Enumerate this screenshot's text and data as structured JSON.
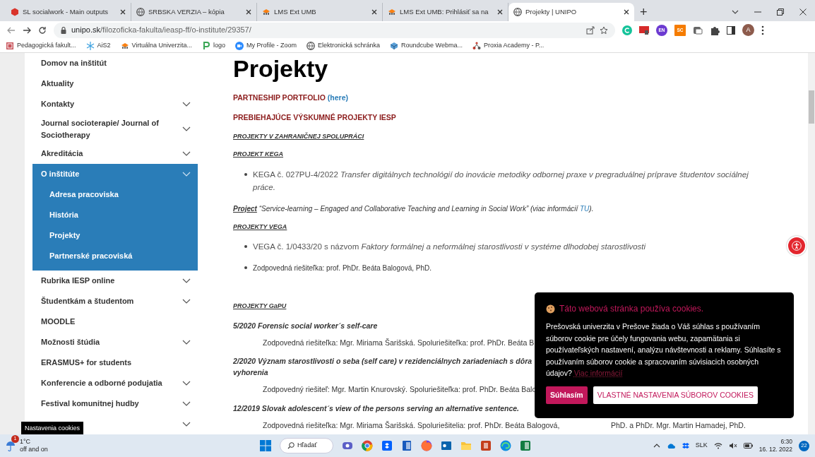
{
  "browser": {
    "tabs": [
      {
        "title": "SL socialwork - Main outputs",
        "selected": false
      },
      {
        "title": "SRBSKA VERZIA – kópia",
        "selected": false
      },
      {
        "title": "LMS Ext UMB",
        "selected": false
      },
      {
        "title": "LMS Ext UMB: Prihlásiť sa na",
        "selected": false
      },
      {
        "title": "Projekty | UNIPO",
        "selected": true
      }
    ],
    "new_tab": "+",
    "address_bar": {
      "domain": "unipo.sk",
      "path": "/filozoficka-fakulta/ieasp-ff/o-institute/29357/"
    },
    "extensions": [
      "EN",
      "SC"
    ],
    "profile_initial": "A",
    "bookmarks": [
      "Pedagogická fakult...",
      "AiS2",
      "Virtuálna Univerzita...",
      "logo",
      "My Profile - Zoom",
      "Elektronická schránka",
      "Roundcube Webma...",
      "Proxia Academy - P..."
    ]
  },
  "sidebar": {
    "items": [
      {
        "label": "Domov na inštitút",
        "expandable": false,
        "expanded": false
      },
      {
        "label": "Aktuality",
        "expandable": false,
        "expanded": false
      },
      {
        "label": "Kontakty",
        "expandable": true,
        "expanded": false
      },
      {
        "label": "Journal socioterapie/ Journal of Sociotherapy",
        "expandable": true,
        "expanded": false
      },
      {
        "label": "Akreditácia",
        "expandable": true,
        "expanded": false
      },
      {
        "label": "O inštitúte",
        "expandable": true,
        "expanded": true,
        "children": [
          {
            "label": "Adresa pracoviska"
          },
          {
            "label": "História"
          },
          {
            "label": "Projekty"
          },
          {
            "label": "Partnerské pracoviská"
          }
        ]
      },
      {
        "label": "Rubrika IESP online",
        "expandable": true,
        "expanded": false
      },
      {
        "label": "Študentkám a študentom",
        "expandable": true,
        "expanded": false
      },
      {
        "label": "MOODLE",
        "expandable": false,
        "expanded": false
      },
      {
        "label": "Možnosti štúdia",
        "expandable": true,
        "expanded": false
      },
      {
        "label": "ERASMUS+ for students",
        "expandable": false,
        "expanded": false
      },
      {
        "label": "Konferencie a odborné podujatia",
        "expandable": true,
        "expanded": false
      },
      {
        "label": "Festival komunitnej hudby",
        "expandable": true,
        "expanded": false
      },
      {
        "expandable": true,
        "expanded": false
      }
    ]
  },
  "page": {
    "title": "Projekty",
    "blocks": [
      {
        "kind": "heading",
        "text": "PARTNESHIP PORTFOLIO",
        "link": "(here)"
      },
      {
        "kind": "heading",
        "text": "PREBIEHAJÚCE VÝSKUMNÉ PROJEKTY IESP"
      },
      {
        "kind": "subheading",
        "text": "PROJEKTY V ZAHRANIČNEJ SPOLUPRÁCI"
      },
      {
        "kind": "subheading",
        "text": "PROJEKT KEGA"
      },
      {
        "kind": "bullet",
        "text": "KEGA č. 027PU-4/2022 *Transfer digitálnych technológií do inovácie metodiky odbornej praxe v pregraduálnej príprave študentov sociálnej práce.*"
      },
      {
        "kind": "project",
        "lead": "Project",
        "text": "“Service-learning – Engaged and Collaborative Teaching and Learning in Social Work”   (viac informácií",
        "link": "TU",
        "tail": ")."
      },
      {
        "kind": "subheading",
        "text": "PROJEKTY VEGA"
      },
      {
        "kind": "bullet",
        "text": "VEGA č. 1/0433/20 s názvom *Faktory formálnej a neformálnej starostlivosti v systéme dlhodobej starostlivosti*"
      },
      {
        "kind": "bullet-small",
        "text": "Zodpovedná riešiteľka: prof. PhDr. Beáta Balogová, PhD."
      },
      {
        "kind": "subheading",
        "text": "PROJEKTY GaPU"
      },
      {
        "kind": "title",
        "lines": [
          "5/2020 Forensic social worker´s self-care"
        ]
      },
      {
        "kind": "person",
        "parts": [
          "Zodpovedná riešiteľka: Mgr. Miriama Šarišská. Spoluriešiteľka: prof. PhDr. Beáta B"
        ]
      },
      {
        "kind": "title",
        "lines": [
          "2/2020 Význam starostlivosti o seba (self care) v rezidenciálnych zariadeniach s dôra",
          "vyhorenia"
        ]
      },
      {
        "kind": "person",
        "parts": [
          "Zodpovedný riešiteľ: Mgr. Martin Knurovský. Spoluriešiteľka: prof. PhDr. Beáta Balo"
        ]
      },
      {
        "kind": "title",
        "lines": [
          "12/2019 Slovak adolescent´s view of the persons serving an alternative sentence."
        ]
      },
      {
        "kind": "person",
        "parts": [
          "Zodpovedná riešiteľka: Mgr. Miriama Šarišská. Spoluriešitelia: prof. PhDr. Beáta Balogová,",
          "PhD. a PhDr. Mgr. Martin Hamadej, PhD."
        ]
      }
    ]
  },
  "cookie_banner": {
    "title": "Táto webová stránka používa cookies.",
    "text": "Prešovská univerzita v Prešove žiada o Váš súhlas s používaním súborov cookie pre účely fungovania webu, zapamätania si používateľských nastavení, analýzu návštevnosti a reklamy. Súhlasíte s používaním súborov cookie a spracovaním súvisiacich osobných údajov?",
    "link": "Viac informácií",
    "buttons": [
      {
        "label": "Súhlasím",
        "kind": "primary"
      },
      {
        "label": "VLASTNÉ NASTAVENIA SÚBOROV COOKIES",
        "kind": "secondary"
      }
    ]
  },
  "cookie_settings_tab": "Nastavenia cookies",
  "taskbar": {
    "weather": {
      "badge": "1",
      "temperature": "1°C",
      "caption": "off and on"
    },
    "search": "Hľadať",
    "language": "SLK",
    "time": "6:30",
    "date": "16. 12. 2022",
    "notifications": "22"
  }
}
